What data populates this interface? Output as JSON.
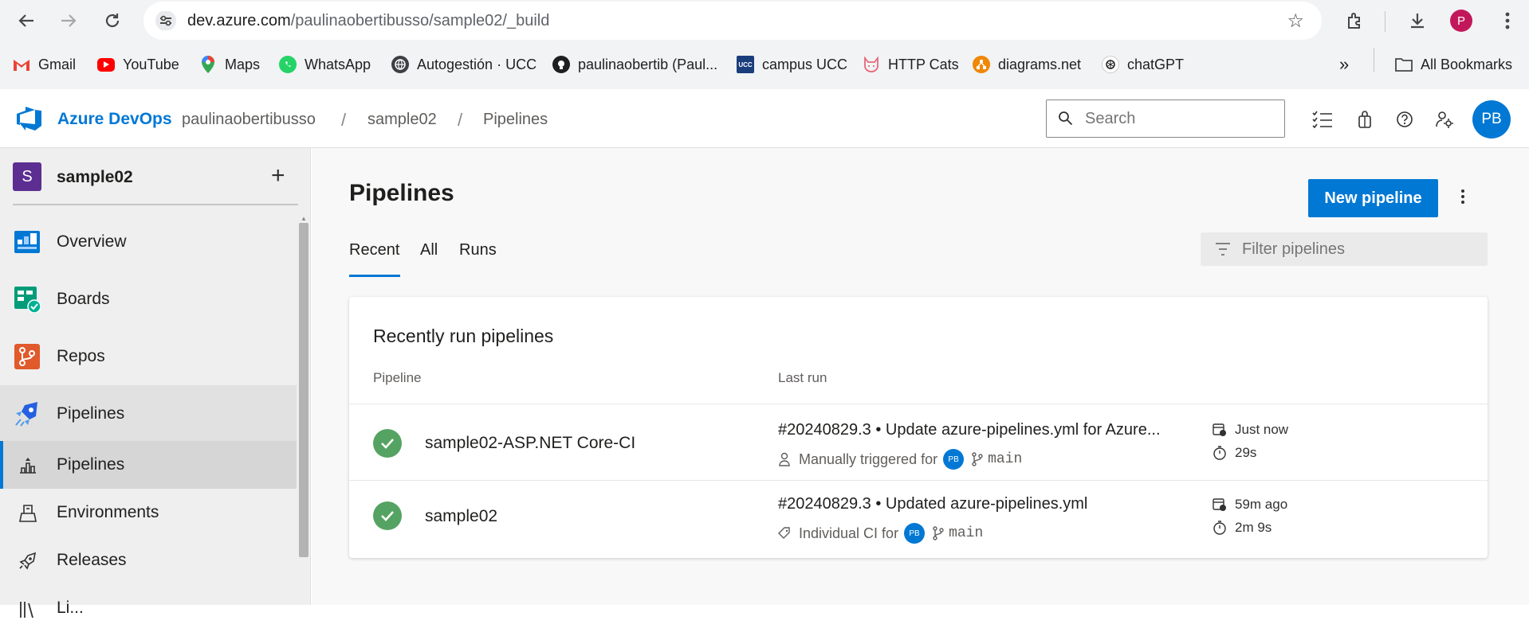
{
  "browser": {
    "url_host": "dev.azure.com",
    "url_path": "/paulinaobertibusso/sample02/_build",
    "profile_initial": "P",
    "bookmarks": [
      {
        "label": "Gmail",
        "icon": "gmail-icon"
      },
      {
        "label": "YouTube",
        "icon": "youtube-icon"
      },
      {
        "label": "Maps",
        "icon": "maps-icon"
      },
      {
        "label": "WhatsApp",
        "icon": "whatsapp-icon"
      },
      {
        "label": "Autogestión · UCC",
        "icon": "globe-icon"
      },
      {
        "label": "paulinaobertib (Paul...",
        "icon": "github-icon"
      },
      {
        "label": "campus UCC",
        "icon": "ucc-icon"
      },
      {
        "label": "HTTP Cats",
        "icon": "cat-icon"
      },
      {
        "label": "diagrams.net",
        "icon": "diagrams-icon"
      },
      {
        "label": "chatGPT",
        "icon": "openai-icon"
      }
    ],
    "all_bookmarks_label": "All Bookmarks"
  },
  "header": {
    "brand": "Azure DevOps",
    "breadcrumbs": [
      "paulinaobertibusso",
      "sample02",
      "Pipelines"
    ],
    "search_placeholder": "Search",
    "user_initials": "PB",
    "accent": "#0078d4"
  },
  "sidebar": {
    "project_initial": "S",
    "project_name": "sample02",
    "items": [
      {
        "label": "Overview",
        "icon": "overview-icon"
      },
      {
        "label": "Boards",
        "icon": "boards-icon"
      },
      {
        "label": "Repos",
        "icon": "repos-icon"
      },
      {
        "label": "Pipelines",
        "icon": "pipelines-icon"
      }
    ],
    "subitems": [
      {
        "label": "Pipelines",
        "icon": "pipelines-rocket-icon",
        "selected": true
      },
      {
        "label": "Environments",
        "icon": "environments-icon"
      },
      {
        "label": "Releases",
        "icon": "releases-icon"
      },
      {
        "label": "Li...",
        "icon": "library-icon"
      }
    ]
  },
  "main": {
    "title": "Pipelines",
    "new_button": "New pipeline",
    "tabs": [
      "Recent",
      "All",
      "Runs"
    ],
    "active_tab": "Recent",
    "filter_placeholder": "Filter pipelines",
    "card_title": "Recently run pipelines",
    "columns": [
      "Pipeline",
      "Last run"
    ],
    "rows": [
      {
        "name": "sample02-ASP.NET Core-CI",
        "run_title": "#20240829.3 • Update azure-pipelines.yml for Azure...",
        "trigger": "Manually triggered for",
        "avatar": "PB",
        "branch": "main",
        "when": "Just now",
        "duration": "29s",
        "status": "succeeded"
      },
      {
        "name": "sample02",
        "run_title": "#20240829.3 • Updated azure-pipelines.yml",
        "trigger": "Individual CI for",
        "avatar": "PB",
        "branch": "main",
        "when": "59m ago",
        "duration": "2m 9s",
        "status": "succeeded"
      }
    ]
  }
}
